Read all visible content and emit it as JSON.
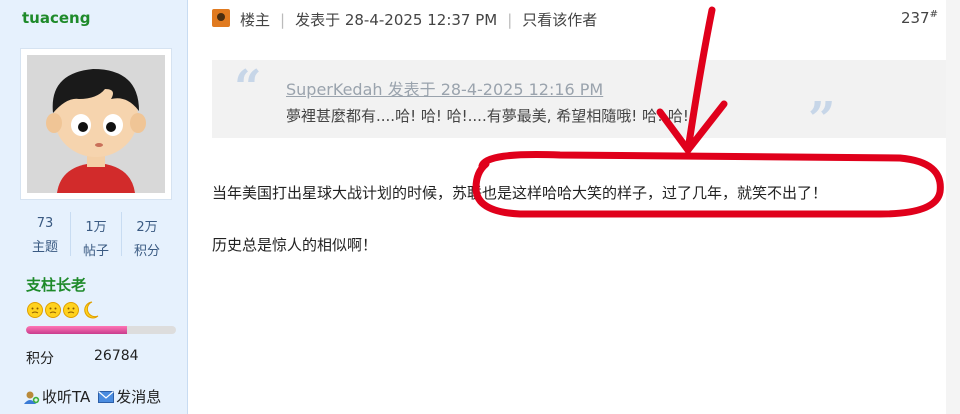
{
  "user": {
    "name": "tuaceng",
    "stats": [
      {
        "value": "73",
        "label": "主题"
      },
      {
        "value": "1万",
        "label": "帖子"
      },
      {
        "value": "2万",
        "label": "积分"
      }
    ],
    "rank": "支柱长老",
    "rank_progress": 0.67,
    "credit_label": "积分",
    "credit_value": "26784",
    "follow_label": "收听TA",
    "message_label": "发消息"
  },
  "post": {
    "floor_label": "楼主",
    "posted_at": "发表于 28-4-2025 12:37 PM",
    "only_author": "只看该作者",
    "floor_number": "237",
    "floor_mark": "#",
    "quote": {
      "author_line": "SuperKedah 发表于 28-4-2025 12:16 PM",
      "text": "夢裡甚麼都有....哈! 哈! 哈!....有夢最美, 希望相隨哦! 哈! 哈!"
    },
    "body": [
      "当年美国打出星球大战计划的时候，苏联也是这样哈哈大笑的样子，过了几年，就笑不出了！",
      "历史总是惊人的相似啊！"
    ]
  },
  "colors": {
    "sidebar_bg": "#e6f1fd",
    "username": "#1e8a2a",
    "annotation": "#e0001b"
  }
}
